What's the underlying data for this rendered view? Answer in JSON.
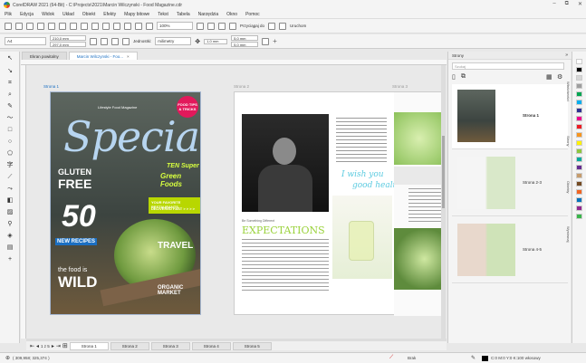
{
  "window": {
    "title": "CorelDRAW 2021 (64-Bit) - C:\\Projects\\2021\\Marcin Wilczynski - Food Magazine.cdr",
    "controls": [
      "–",
      "⧉",
      "✕"
    ]
  },
  "menu": [
    "Plik",
    "Edycja",
    "Widok",
    "Układ",
    "Obiekt",
    "Efekty",
    "Mapy bitowe",
    "Tekst",
    "Tabela",
    "Narzędzia",
    "Okno",
    "Pomoc"
  ],
  "toolbar1": {
    "zoom": "100%",
    "snap_label": "Przyciągaj do",
    "launch_label": "Uruchom"
  },
  "toolbar2": {
    "paper": "A4",
    "width": "210,0 mm",
    "height": "297,0 mm",
    "unit_label": "Jednostki:",
    "unit_value": "milimetry",
    "nudge": "1,0 mm",
    "dup_x": "5,0 mm",
    "dup_y": "5,0 mm"
  },
  "doc_tabs": [
    {
      "label": "Ekran powitalny",
      "active": false
    },
    {
      "label": "Marcin Wilczynski - Foo...",
      "active": true
    }
  ],
  "pages": {
    "page1_label": "Strona 1",
    "page2_label": "Strona 2",
    "page3_label": "Strona 3"
  },
  "cover": {
    "badge": "FOOD TIPS & TRICKS",
    "lifestyle": "Lifestyle Food Magazine",
    "headline": "Specials",
    "ten_super": "TEN Super",
    "green_foods": "Green Foods",
    "gluten": "GLUTEN",
    "free": "FREE",
    "favorite": "YOUR FAVORITE RESTAURANTS.",
    "delivered": "DELIVERED FAST > > > >",
    "fifty": "50",
    "new_recipes": "NEW RECIPES",
    "travel": "TRAVEL",
    "wild_line1": "the food is",
    "wild": "WILD",
    "organic": "ORGANIC MARKET"
  },
  "spread": {
    "script1": "I wish you",
    "script2": "good health.",
    "expectations": "EXPECTATIONS",
    "kicker": "Be Something Different"
  },
  "docker": {
    "title": "Strony",
    "search_placeholder": "Szukaj",
    "items": [
      {
        "label": "Strona 1"
      },
      {
        "label": "Strona 2-3"
      },
      {
        "label": "Strona 4-5"
      }
    ]
  },
  "side_tabs": [
    "Właściwości",
    "Strony",
    "Obiekty",
    "Wyrównaj"
  ],
  "page_nav": {
    "counter": "1 z 5",
    "tabs": [
      "Strona 1",
      "Strona 2",
      "Strona 3",
      "Strona 4",
      "Strona 5"
    ],
    "active_index": 0
  },
  "status": {
    "coords": "( 309,958; 325,374 )",
    "fill": "Brak",
    "color_info": "C:0 M:0 Y:0 K:100 włosowy"
  },
  "palette": [
    "#ffffff",
    "#000000",
    "#d6d6d6",
    "#9e9e9e",
    "#00a651",
    "#00aeef",
    "#2e3192",
    "#ec008c",
    "#ed1c24",
    "#f7941d",
    "#fff200",
    "#8dc63f",
    "#00a99d",
    "#662d91",
    "#c69c6d",
    "#754c24",
    "#f26522",
    "#0072bc",
    "#92278f",
    "#39b54a"
  ]
}
